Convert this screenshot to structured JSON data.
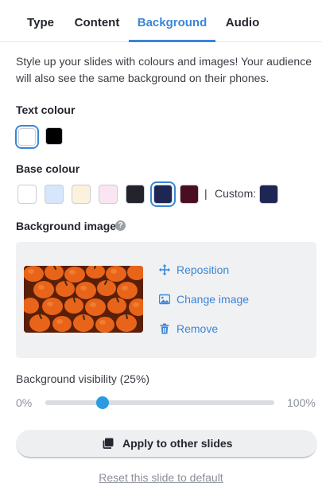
{
  "tabs": [
    {
      "label": "Type"
    },
    {
      "label": "Content"
    },
    {
      "label": "Background"
    },
    {
      "label": "Audio"
    }
  ],
  "active_tab": "Background",
  "description": "Style up your slides with colours and images! Your audience will also see the same background on their phones.",
  "text_colour": {
    "label": "Text colour",
    "options": [
      "#ffffff",
      "#000000"
    ],
    "selected": "#ffffff"
  },
  "base_colour": {
    "label": "Base colour",
    "options": [
      "#ffffff",
      "#d6e6fb",
      "#fcf1dd",
      "#fbe5f3",
      "#23232b",
      "#1e2754",
      "#4a0e22"
    ],
    "selected": "#1e2754",
    "divider": "|",
    "custom_label": "Custom:",
    "custom_value": "#1e2754"
  },
  "background_image": {
    "label": "Background image",
    "help_icon": "question-circle-icon",
    "actions": {
      "reposition": "Reposition",
      "change": "Change image",
      "remove": "Remove"
    }
  },
  "visibility": {
    "label": "Background visibility (25%)",
    "min_label": "0%",
    "max_label": "100%",
    "value": 0.25
  },
  "apply_button": "Apply to other slides",
  "reset_link": "Reset this slide to default",
  "colors": {
    "accent": "#3a86d6",
    "slider_thumb": "#2a9be0"
  }
}
